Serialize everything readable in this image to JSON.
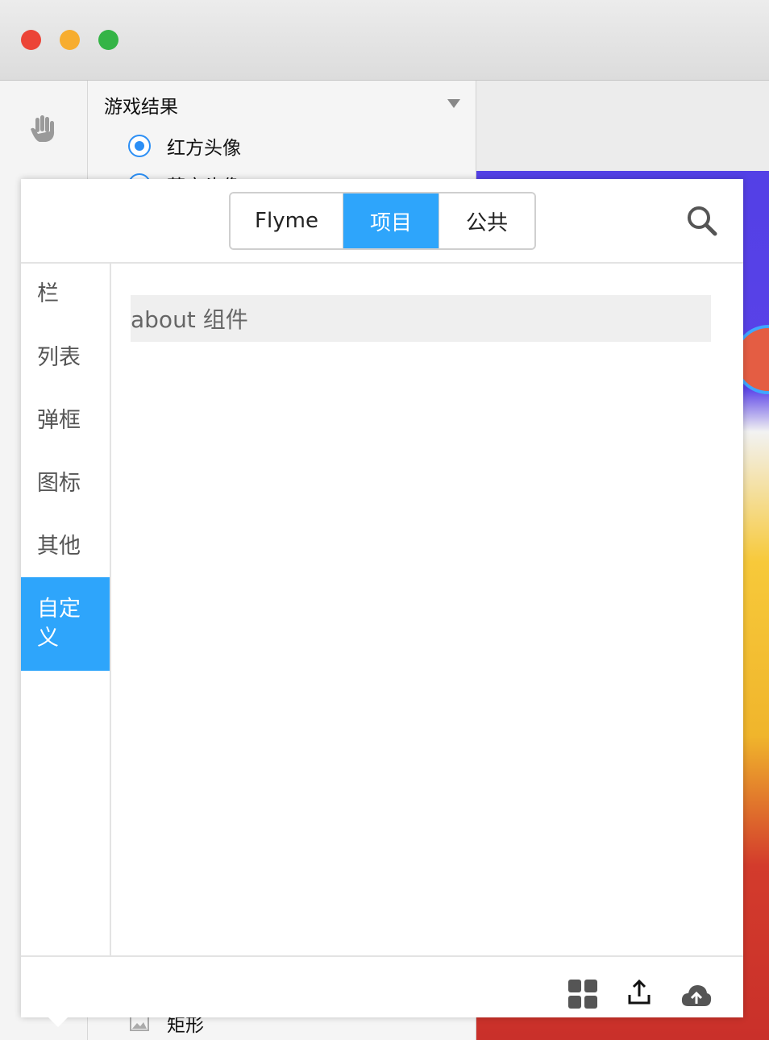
{
  "layers": {
    "group_title": "游戏结果",
    "items": [
      "红方头像",
      "蓝方头像"
    ],
    "bottom_item": "矩形"
  },
  "popup": {
    "tabs": [
      "Flyme",
      "项目",
      "公共"
    ],
    "active_tab": "项目",
    "categories": [
      "栏",
      "列表",
      "弹框",
      "图标",
      "其他",
      "自定义"
    ],
    "active_category": "自定义",
    "components": [
      "about 组件"
    ]
  },
  "colors": {
    "accent": "#2ea5fb",
    "radio": "#2c8ff5",
    "close": "#ec4437",
    "minimize": "#f7ad2f",
    "maximize": "#34b446"
  },
  "icons": {
    "toolstrip": "hand-icon",
    "header": "search-icon",
    "footer": [
      "grid-icon",
      "upload-icon",
      "cloud-upload-icon"
    ]
  }
}
